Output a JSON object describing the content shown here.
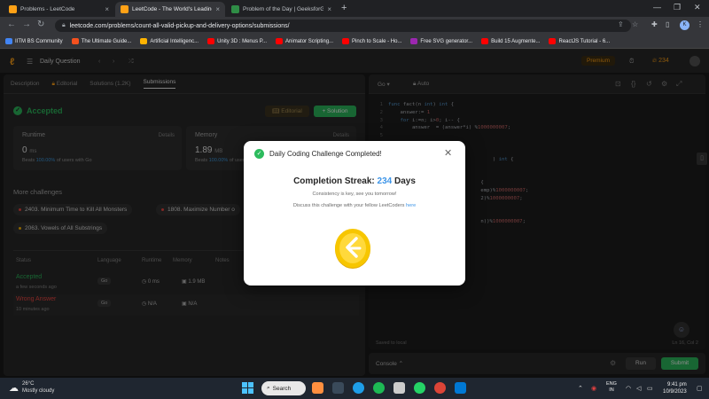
{
  "browser": {
    "tabs": [
      {
        "title": "Problems - LeetCode",
        "active": false,
        "fav": "#ffa116"
      },
      {
        "title": "LeetCode - The World's Leading",
        "active": true,
        "fav": "#ffa116"
      },
      {
        "title": "Problem of the Day | GeeksforGe",
        "active": false,
        "fav": "#2f8d46"
      }
    ],
    "url": "leetcode.com/problems/count-all-valid-pickup-and-delivery-options/submissions/",
    "profile_initial": "K",
    "bookmarks": [
      {
        "label": "IITM BS Community",
        "color": "#4285f4"
      },
      {
        "label": "The Ultimate Guide...",
        "color": "#f4511e"
      },
      {
        "label": "Artificial Intelligenc...",
        "color": "#ffb300"
      },
      {
        "label": "Unity 3D : Menus P...",
        "color": "#ff0000"
      },
      {
        "label": "Animator Scripting...",
        "color": "#ff0000"
      },
      {
        "label": "Pinch to Scale - Ho...",
        "color": "#ff0000"
      },
      {
        "label": "Free SVG generator...",
        "color": "#9c27b0"
      },
      {
        "label": "Build 15 Augmente...",
        "color": "#ff0000"
      },
      {
        "label": "ReactJS Tutorial - 6...",
        "color": "#ff0000"
      }
    ]
  },
  "lc": {
    "daily_label": "Daily Question",
    "premium": "Premium",
    "streak_count": "234",
    "tabs": [
      "Description",
      "Editorial",
      "Solutions (1.2K)",
      "Submissions"
    ],
    "status": "Accepted",
    "editorial_btn": "Editorial",
    "solution_btn": "Solution",
    "runtime": {
      "title": "Runtime",
      "details": "Details",
      "value": "0",
      "unit": "ms",
      "beats_pct": "100.00%",
      "beats_text": "of users with Go"
    },
    "memory": {
      "title": "Memory",
      "details": "Details",
      "value": "1.89",
      "unit": "MB",
      "beats_pct": "100.00%",
      "beats_text": "of users with Go"
    },
    "more_challenges": "More challenges",
    "challenges": [
      {
        "label": "2403. Minimum Time to Kill All Monsters",
        "dot": "#ef4743"
      },
      {
        "label": "1808. Maximize Number o",
        "dot": "#ef4743"
      },
      {
        "label": "2063. Vowels of All Substrings",
        "dot": "#ffb800"
      }
    ],
    "headers": {
      "status": "Status",
      "language": "Language",
      "runtime": "Runtime",
      "memory": "Memory",
      "notes": "Notes"
    },
    "submissions": [
      {
        "status": "Accepted",
        "color": "#2cbb5d",
        "time": "a few seconds ago",
        "lang": "Go",
        "runtime": "0 ms",
        "memory": "1.9 MB"
      },
      {
        "status": "Wrong Answer",
        "color": "#ef4743",
        "time": "10 minutes ago",
        "lang": "Go",
        "runtime": "N/A",
        "memory": "N/A"
      }
    ],
    "editor_lang": "Go",
    "editor_auto": "Auto",
    "saved": "Saved to local",
    "cursor": "Ln 16, Col 2",
    "console": "Console",
    "run": "Run",
    "submit": "Submit"
  },
  "modal": {
    "title": "Daily Coding Challenge Completed!",
    "streak_label": "Completion Streak:",
    "streak_value": "234",
    "streak_unit": "Days",
    "line1": "Consistency is key, see you tomorrow!",
    "line2": "Discuss this challenge with your fellow LeetCoders",
    "link": "here"
  },
  "taskbar": {
    "temp": "26°C",
    "weather": "Mostly cloudy",
    "search": "Search",
    "lang1": "ENG",
    "lang2": "IN",
    "time": "9:41 pm",
    "date": "10/9/2023"
  },
  "colors": {
    "accent": "#ffa116",
    "green": "#2cbb5d",
    "red": "#ef4743",
    "blue": "#3d95e8"
  }
}
